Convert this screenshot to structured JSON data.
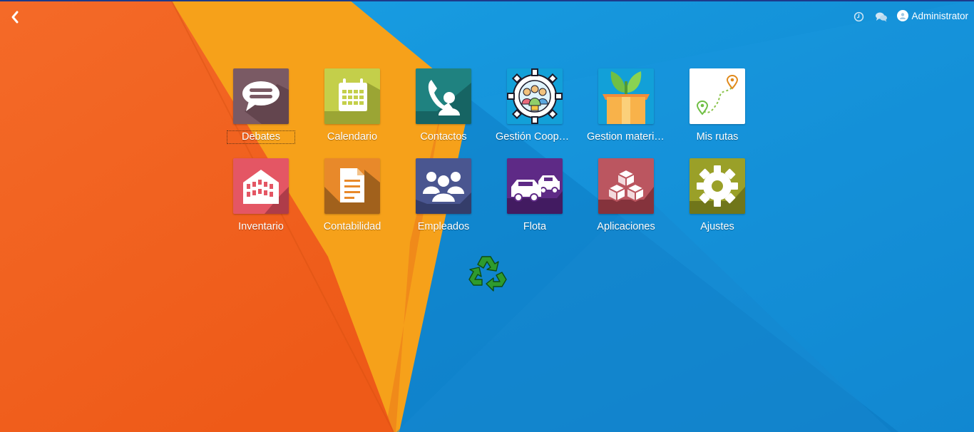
{
  "topbar": {
    "back_icon": "chevron-left-icon",
    "activity_icon": "clock-icon",
    "messages_icon": "chat-bubbles-icon",
    "user_name": "Administrator"
  },
  "apps": [
    {
      "label": "Debates",
      "icon": "chat-bubble-icon",
      "color": "#7a5a64"
    },
    {
      "label": "Calendario",
      "icon": "calendar-icon",
      "color": "#c4cf4a"
    },
    {
      "label": "Contactos",
      "icon": "contact-phone-icon",
      "color": "#1f8280"
    },
    {
      "label": "Gestión Cooperativa",
      "icon": "cooperative-gear-icon",
      "color": "#12a0d8"
    },
    {
      "label": "Gestion materiales",
      "icon": "plant-box-icon",
      "color": "#12a0d8"
    },
    {
      "label": "Mis rutas",
      "icon": "route-map-icon",
      "color": "#ffffff"
    },
    {
      "label": "Inventario",
      "icon": "warehouse-icon",
      "color": "#e45664"
    },
    {
      "label": "Contabilidad",
      "icon": "document-icon",
      "color": "#e8892a"
    },
    {
      "label": "Empleados",
      "icon": "people-icon",
      "color": "#4a5690"
    },
    {
      "label": "Flota",
      "icon": "cars-icon",
      "color": "#5e2a86"
    },
    {
      "label": "Aplicaciones",
      "icon": "cubes-icon",
      "color": "#bb5660"
    },
    {
      "label": "Ajustes",
      "icon": "gear-icon",
      "color": "#9aa028"
    }
  ],
  "decor": {
    "icon": "recycle-icon"
  },
  "colors": {
    "orange": "#f26322",
    "yellow": "#f6a11a",
    "blue": "#1390d8"
  }
}
